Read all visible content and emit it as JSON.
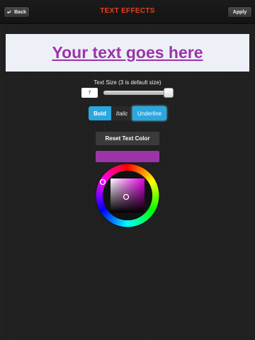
{
  "header": {
    "back_label": "Back",
    "title": "TEXT EFFECTS",
    "apply_label": "Apply"
  },
  "preview": {
    "text": "Your text goes here",
    "text_color": "#9b34a8"
  },
  "text_size": {
    "label": "Text Size (3 is default size)",
    "value": "7"
  },
  "style_buttons": {
    "bold": "Bold",
    "italic": "Italic",
    "underline": "Underline"
  },
  "reset_label": "Reset Text Color",
  "colors": {
    "accent": "#2ba7de",
    "title": "#e8401e",
    "selected": "#9b34a8"
  }
}
